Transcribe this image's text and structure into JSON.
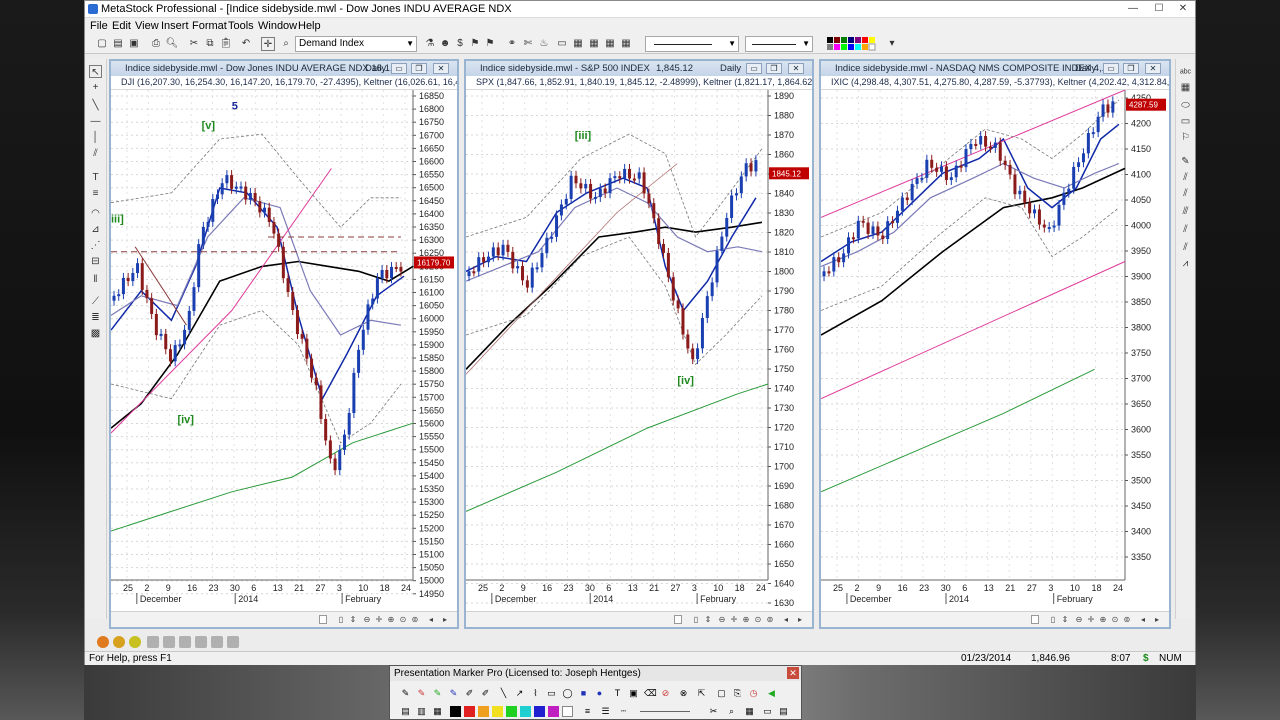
{
  "app": {
    "title": "MetaStock Professional - [Indice sidebyside.mwl - Dow Jones INDU AVERAGE NDX",
    "minimize": "—",
    "maximize": "☐",
    "close": "✕"
  },
  "menu": [
    "File",
    "Edit",
    "View",
    "Insert",
    "Format",
    "Tools",
    "Window",
    "Help"
  ],
  "toolbar": {
    "security_combo": "Demand Index",
    "line_combo_1": "",
    "line_combo_2": ""
  },
  "windows": [
    {
      "title": "Indice sidebyside.mwl - Dow Jones INDU AVERAGE NDX   16,1...",
      "period": "Daily",
      "legend": "DJI (16,207.30, 16,254.30, 16,147.20, 16,179.70, -27.4395), Keltner (16,026.61, 16,413.9",
      "price_box": "16179.70",
      "wave_labels": [
        "5",
        "[v]",
        "iii]",
        "[iv]"
      ],
      "y_ticks": [
        "16850",
        "16800",
        "16750",
        "16700",
        "16650",
        "16600",
        "16550",
        "16500",
        "16450",
        "16400",
        "16350",
        "16300",
        "16250",
        "16200",
        "16150",
        "16100",
        "16050",
        "16000",
        "15950",
        "15900",
        "15850",
        "15800",
        "15750",
        "15700",
        "15650",
        "15600",
        "15550",
        "15500",
        "15450",
        "15400",
        "15350",
        "15300",
        "15250",
        "15200",
        "15150",
        "15100",
        "15050",
        "15000",
        "14950"
      ],
      "x_ticks": [
        "25",
        "2",
        "9",
        "16",
        "23",
        "30",
        "6",
        "13",
        "21",
        "27",
        "3",
        "10",
        "18",
        "24"
      ],
      "x_months": [
        "December",
        "2014",
        "February"
      ]
    },
    {
      "title": "Indice sidebyside.mwl - S&P 500 INDEX",
      "value": "1,845.12",
      "period": "Daily",
      "legend": "SPX (1,847.66, 1,852.91, 1,840.19, 1,845.12, -2.48999), Keltner (1,821.17, 1,864.62, 1,77",
      "price_box": "1845.12",
      "wave_labels": [
        "[iii]",
        "[iv]"
      ],
      "y_ticks": [
        "1890",
        "1880",
        "1870",
        "1860",
        "1850",
        "1840",
        "1830",
        "1820",
        "1810",
        "1800",
        "1790",
        "1780",
        "1770",
        "1760",
        "1750",
        "1740",
        "1730",
        "1720",
        "1710",
        "1700",
        "1690",
        "1680",
        "1670",
        "1660",
        "1650",
        "1640",
        "1630"
      ],
      "x_ticks": [
        "25",
        "2",
        "9",
        "16",
        "23",
        "30",
        "6",
        "13",
        "21",
        "27",
        "3",
        "10",
        "18",
        "24"
      ],
      "x_months": [
        "December",
        "2014",
        "February"
      ]
    },
    {
      "title": "Indice sidebyside.mwl - NASDAQ NMS COMPOSITE INDEX  4,...",
      "period": "Daily",
      "legend": "IXIC (4,298.48, 4,307.51, 4,275.80, 4,287.59, -5.37793), Keltner (4,202.42, 4,312.84, 4,09",
      "price_box": "4287.59",
      "y_ticks": [
        "4250",
        "4200",
        "4150",
        "4100",
        "4050",
        "4000",
        "3950",
        "3900",
        "3850",
        "3800",
        "3750",
        "3700",
        "3650",
        "3600",
        "3550",
        "3500",
        "3450",
        "3400",
        "3350"
      ],
      "x_ticks": [
        "25",
        "2",
        "9",
        "16",
        "23",
        "30",
        "6",
        "13",
        "21",
        "27",
        "3",
        "10",
        "18",
        "24"
      ],
      "x_months": [
        "December",
        "2014",
        "February"
      ]
    }
  ],
  "status": {
    "help": "For Help, press F1",
    "date": "01/23/2014",
    "value": "1,846.96",
    "time": "8:07",
    "dollar": "$",
    "num": "NUM"
  },
  "presentation_marker": {
    "title": "Presentation Marker Pro (Licensed to: Joseph Hentges)",
    "close": "✕"
  },
  "colors": {
    "up_candle": "#1a3fb0",
    "down_candle": "#8b1a1a",
    "ma_fast": "#1029a8",
    "ma_slow": "#000000",
    "ma_mid": "#7a7ab8",
    "long_ma": "#2b9a3a",
    "trendline": "#e0399b",
    "wave_label_green": "#1e8a1e",
    "wave_label_blue": "#1a2a9a",
    "price_box": "#c00000"
  }
}
